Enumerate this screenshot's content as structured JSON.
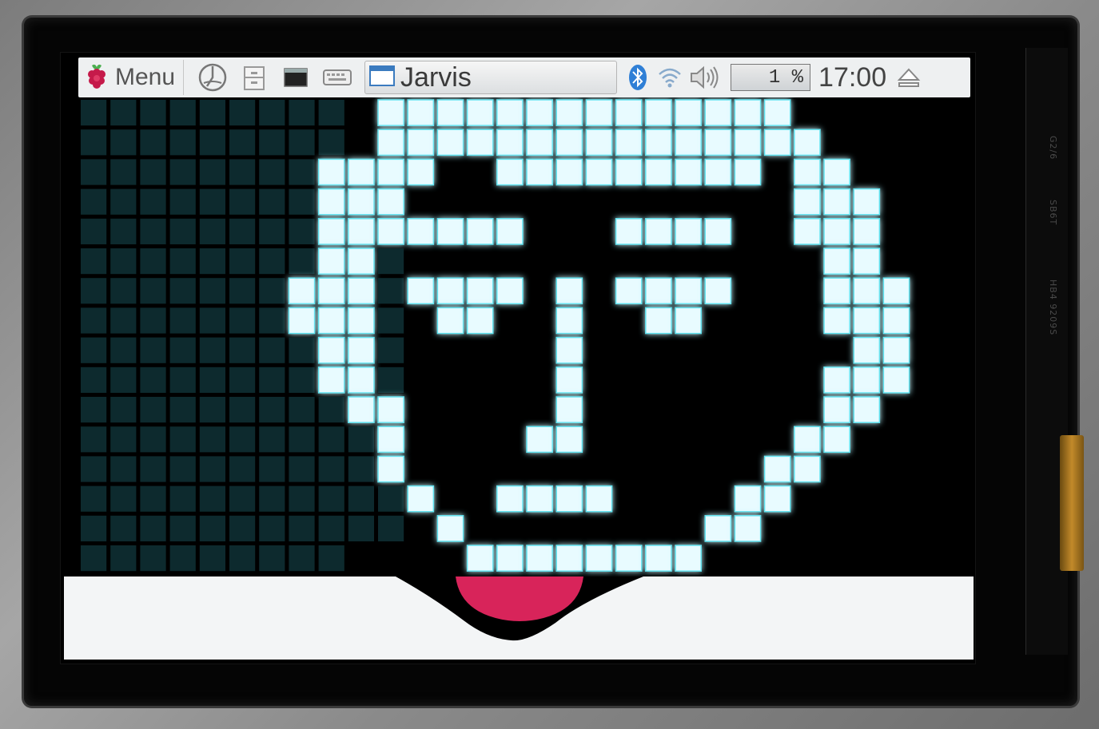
{
  "taskbar": {
    "menu_label": "Menu",
    "launcher_icons": [
      "web-browser-icon",
      "file-manager-icon",
      "terminal-icon",
      "keyboard-icon"
    ],
    "task_label": "Jarvis",
    "tray_icons": [
      "bluetooth-icon",
      "wifi-icon",
      "volume-icon"
    ],
    "cpu_usage": "1 %",
    "clock": "17:00",
    "eject_icon": "eject-icon"
  },
  "app": {
    "name": "Jarvis",
    "face": "pixel-face",
    "mouth": "tongue"
  },
  "colors": {
    "pixel_on": "#e8fbff",
    "pixel_glow": "#5fe3f0",
    "pixel_off": "#0d2a2e",
    "tongue": "#d8245a",
    "taskbar_bg": "#eef0f1"
  },
  "device": {
    "pcb_labels": [
      "G2/6",
      "SB6T",
      "HB4 9209S"
    ]
  }
}
